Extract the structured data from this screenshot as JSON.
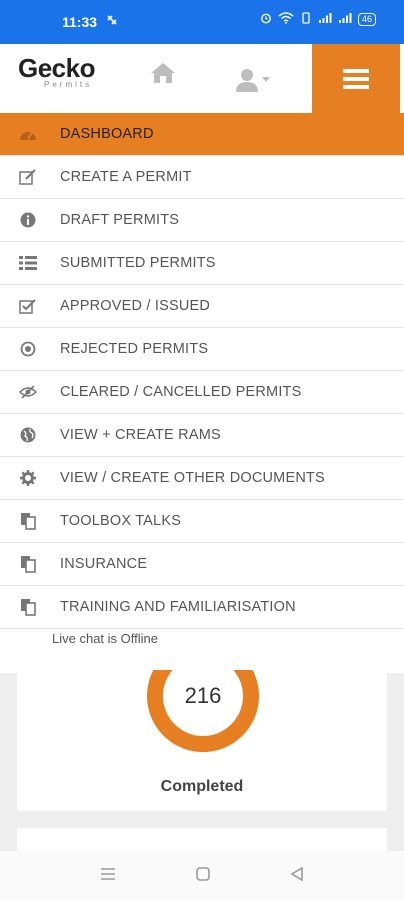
{
  "status_bar": {
    "time": "11:33",
    "battery": "46"
  },
  "header": {
    "logo_text": "Gecko",
    "logo_subtext": "Permits"
  },
  "menu": {
    "items": [
      {
        "label": "DASHBOARD",
        "icon": "dashboard-icon",
        "active": true
      },
      {
        "label": "CREATE A PERMIT",
        "icon": "edit-icon"
      },
      {
        "label": "DRAFT PERMITS",
        "icon": "info-icon"
      },
      {
        "label": "SUBMITTED PERMITS",
        "icon": "list-icon"
      },
      {
        "label": "APPROVED / ISSUED",
        "icon": "checkbox-icon"
      },
      {
        "label": "REJECTED PERMITS",
        "icon": "target-icon"
      },
      {
        "label": "CLEARED / CANCELLED PERMITS",
        "icon": "eye-slash-icon"
      },
      {
        "label": "VIEW + CREATE RAMS",
        "icon": "globe-icon"
      },
      {
        "label": "VIEW / CREATE OTHER DOCUMENTS",
        "icon": "gear-icon"
      },
      {
        "label": "TOOLBOX TALKS",
        "icon": "copy-icon"
      },
      {
        "label": "INSURANCE",
        "icon": "copy-icon"
      },
      {
        "label": "TRAINING AND FAMILIARISATION",
        "icon": "copy-icon"
      }
    ],
    "chat_status": "Live chat is Offline"
  },
  "dashboard": {
    "completed_count": "216",
    "completed_label": "Completed"
  },
  "colors": {
    "accent": "#e67e22",
    "status_bar": "#1a73e8"
  }
}
